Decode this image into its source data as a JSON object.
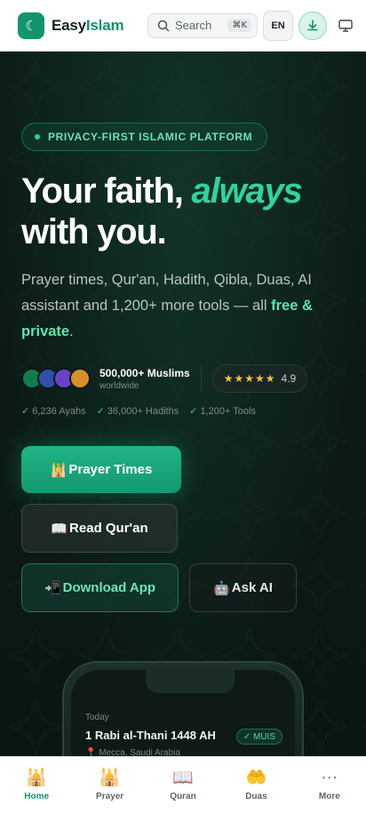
{
  "header": {
    "brand_prefix": "Easy",
    "brand_suffix": "Islam",
    "search_label": "Search",
    "search_shortcut": "⌘K",
    "language": "EN"
  },
  "hero": {
    "badge": "PRIVACY-FIRST ISLAMIC PLATFORM",
    "headline_line1_start": "Your faith, ",
    "headline_line1_emphasis": "always",
    "headline_line2": "with you.",
    "description_start": "Prayer times, Qur'an, Hadith, Qibla, Duas, AI assistant and 1,200+ more tools — all ",
    "description_highlight": "free & private",
    "description_end": ".",
    "users_count": "500,000+ Muslims",
    "users_sub": "worldwide",
    "rating_stars": "★★★★★",
    "rating_value": "4.9",
    "counts": [
      "6,236 Ayahs",
      "36,000+ Hadiths",
      "1,200+ Tools"
    ],
    "buttons": {
      "prayer": "Prayer Times",
      "quran": "Read Qur'an",
      "download": "Download App",
      "ai": "Ask AI"
    }
  },
  "phone_preview": {
    "label": "Today",
    "date": "1 Rabi al-Thani 1448 AH",
    "location": "Mecca, Saudi Arabia",
    "method": "✓ MUIS"
  },
  "bottom_nav": [
    {
      "label": "Home",
      "icon": "mosque-icon",
      "glyph": "🕌",
      "active": true
    },
    {
      "label": "Prayer",
      "icon": "prayer-icon",
      "glyph": "🕌",
      "active": false
    },
    {
      "label": "Quran",
      "icon": "book-icon",
      "glyph": "📖",
      "active": false
    },
    {
      "label": "Duas",
      "icon": "hands-icon",
      "glyph": "🤲",
      "active": false
    },
    {
      "label": "More",
      "icon": "more-icon",
      "glyph": "⋯",
      "active": false
    }
  ],
  "colors": {
    "brand": "#13946d",
    "accent_green": "#33d29a",
    "background": "#0c1a16",
    "star": "#f5c242"
  }
}
